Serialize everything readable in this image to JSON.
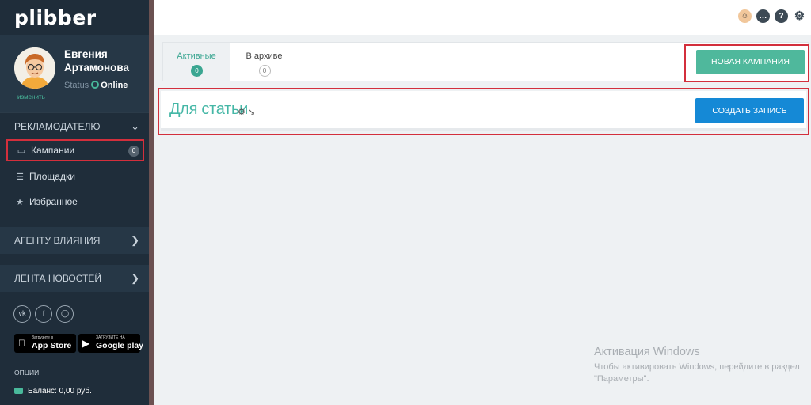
{
  "app": {
    "logo": "plibber"
  },
  "profile": {
    "name": "Евгения Артамонова",
    "change_link": "изменить",
    "status_label": "Status",
    "status_value": "Online"
  },
  "sidebar": {
    "section_advertiser": "РЕКЛАМОДАТЕЛЮ",
    "items": [
      {
        "label": "Кампании",
        "icon": "megaphone-icon",
        "badge": "0"
      },
      {
        "label": "Площадки",
        "icon": "list-icon"
      },
      {
        "label": "Избранное",
        "icon": "star-icon"
      }
    ],
    "section_agent": "АГЕНТУ ВЛИЯНИЯ",
    "section_news": "ЛЕНТА НОВОСТЕЙ",
    "socials": [
      "vk-icon",
      "facebook-icon",
      "instagram-icon"
    ],
    "app_store": {
      "small": "Загрузите в",
      "big": "App Store"
    },
    "google_play": {
      "small": "ЗАГРУЗИТЕ НА",
      "big": "Google play"
    },
    "options_label": "ОПЦИИ",
    "balance": "Баланс: 0,00 руб."
  },
  "topbar": {
    "icons": [
      "user-avatar-icon",
      "chat-icon",
      "help-icon",
      "gear-icon"
    ]
  },
  "tabs": [
    {
      "label": "Активные",
      "count": "0"
    },
    {
      "label": "В архиве",
      "count": "0"
    }
  ],
  "buttons": {
    "new_campaign": "НОВАЯ КАМПАНИЯ",
    "create_record": "СОЗДАТЬ ЗАПИСЬ"
  },
  "campaign": {
    "title": "Для статьи"
  },
  "watermark": {
    "title": "Активация Windows",
    "text": "Чтобы активировать Windows, перейдите в раздел \"Параметры\"."
  },
  "colors": {
    "sidebar_bg": "#1f2d3a",
    "accent_green": "#4fb89c",
    "accent_blue": "#1589d6",
    "highlight_red": "#d32f3c"
  }
}
